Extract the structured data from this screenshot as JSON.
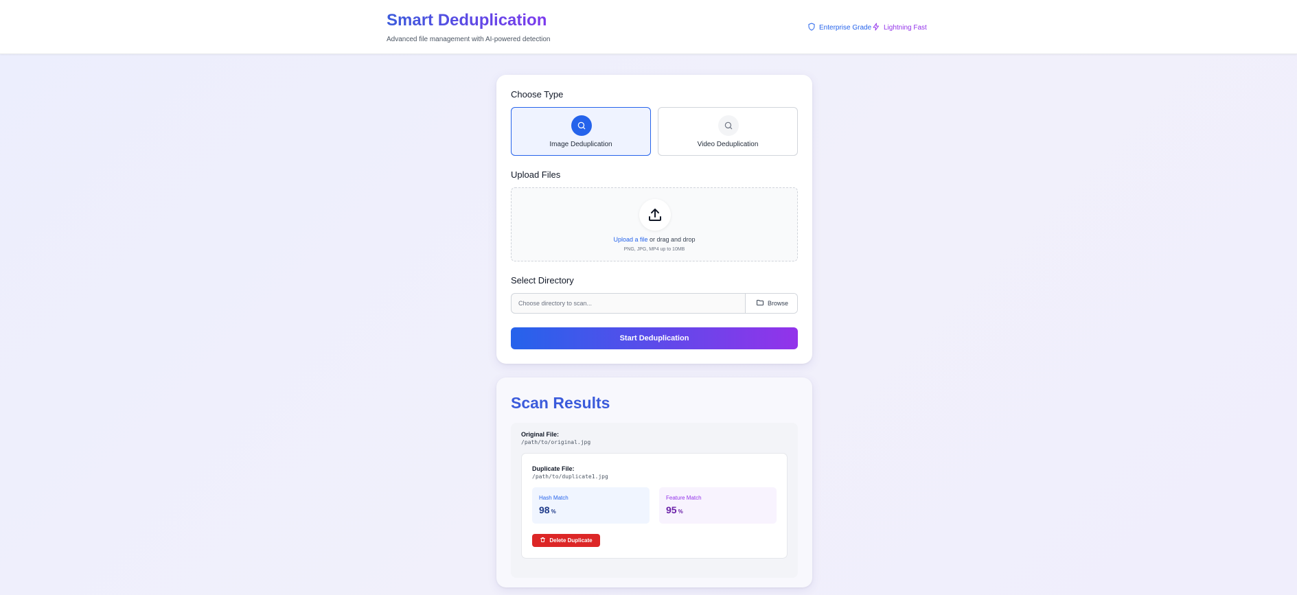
{
  "header": {
    "title": "Smart Deduplication",
    "subtitle": "Advanced file management with AI-powered detection",
    "badges": [
      {
        "label": "Enterprise Grade",
        "icon": "shield-icon",
        "color": "#2563eb"
      },
      {
        "label": "Lightning Fast",
        "icon": "lightning-icon",
        "color": "#9333ea"
      }
    ]
  },
  "form": {
    "choose_type_label": "Choose Type",
    "types": [
      {
        "label": "Image Deduplication",
        "icon": "search-icon",
        "selected": true
      },
      {
        "label": "Video Deduplication",
        "icon": "search-icon",
        "selected": false
      }
    ],
    "upload_label": "Upload Files",
    "upload": {
      "link_text": "Upload a file",
      "rest_text": " or drag and drop",
      "hint": "PNG, JPG, MP4 up to 10MB",
      "icon": "upload-icon"
    },
    "directory_label": "Select Directory",
    "directory": {
      "placeholder": "Choose directory to scan...",
      "value": "",
      "browse_label": "Browse",
      "browse_icon": "folder-icon"
    },
    "start_label": "Start Deduplication",
    "accent_gradient": [
      "#2563eb",
      "#9333ea"
    ]
  },
  "results": {
    "title": "Scan Results",
    "original_label": "Original File:",
    "original_path": "/path/to/original.jpg",
    "duplicates": [
      {
        "label": "Duplicate File:",
        "path": "/path/to/duplicate1.jpg",
        "hash_match_label": "Hash Match",
        "hash_match": "98",
        "feature_match_label": "Feature Match",
        "feature_match": "95",
        "unit": "%",
        "delete_label": "Delete Duplicate",
        "delete_icon": "trash-icon",
        "delete_color": "#dc2626"
      }
    ]
  }
}
